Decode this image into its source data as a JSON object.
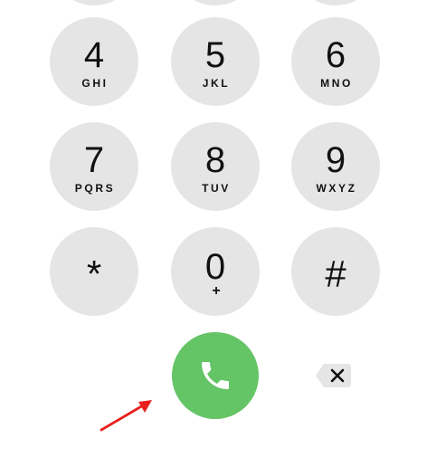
{
  "keypad": {
    "rows": [
      [
        {
          "digit": "4",
          "letters": "GHI"
        },
        {
          "digit": "5",
          "letters": "JKL"
        },
        {
          "digit": "6",
          "letters": "MNO"
        }
      ],
      [
        {
          "digit": "7",
          "letters": "PQRS"
        },
        {
          "digit": "8",
          "letters": "TUV"
        },
        {
          "digit": "9",
          "letters": "WXYZ"
        }
      ],
      [
        {
          "digit": "*",
          "letters": ""
        },
        {
          "digit": "0",
          "letters": "+"
        },
        {
          "digit": "#",
          "letters": ""
        }
      ]
    ]
  },
  "actions": {
    "call_icon": "phone-icon",
    "delete_icon": "backspace-icon"
  },
  "annotation": {
    "arrow_icon": "red-arrow-icon"
  },
  "colors": {
    "key_background": "#e5e5e5",
    "call_green": "#65c466",
    "annotation_red": "#e8201e",
    "text": "#111111"
  }
}
